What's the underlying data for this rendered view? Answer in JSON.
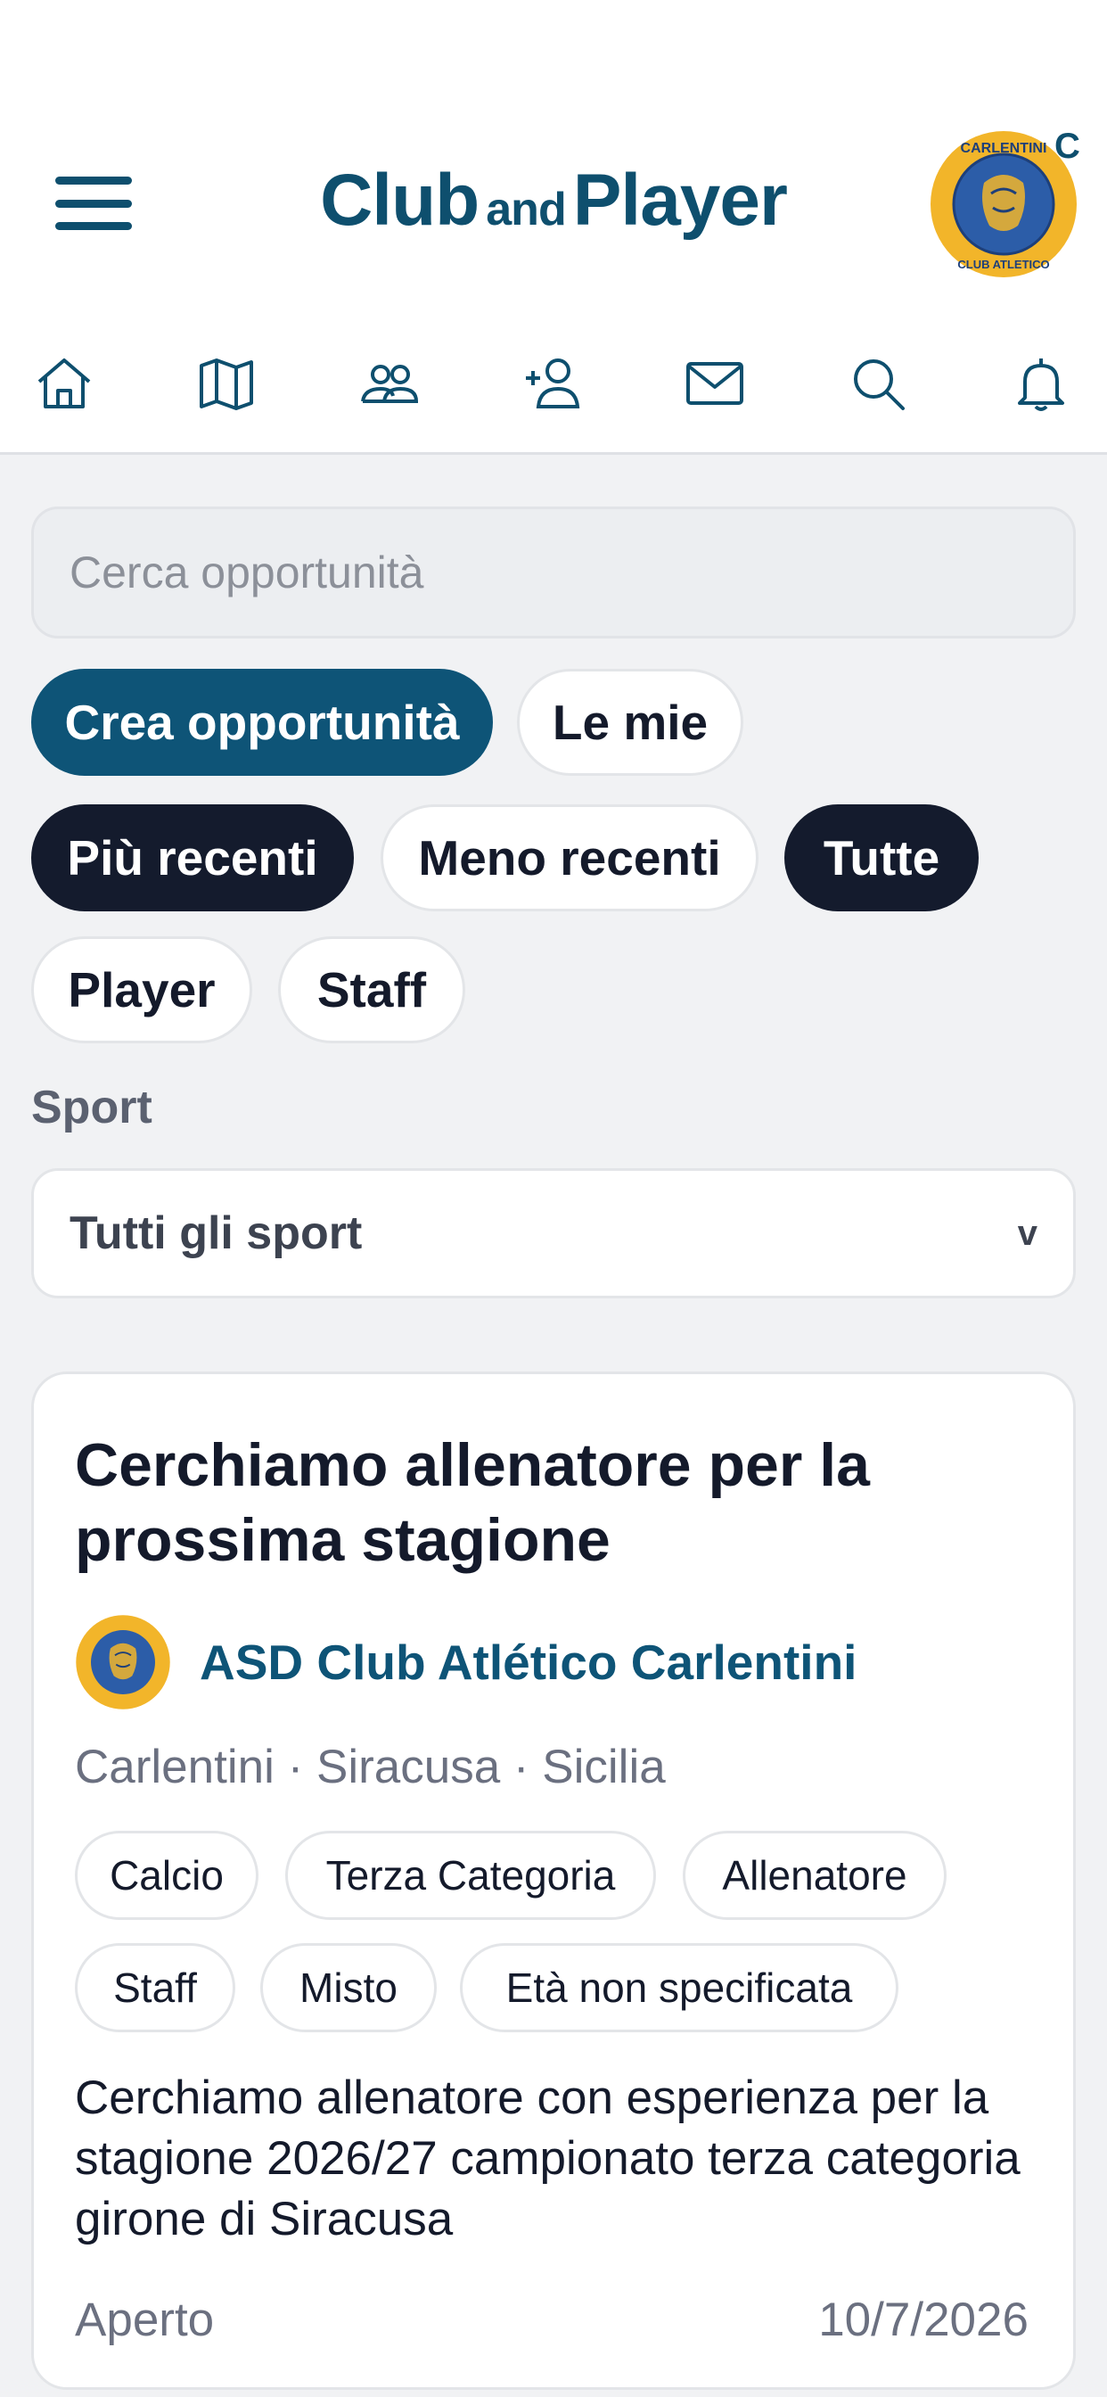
{
  "header": {
    "logo_club": "Club",
    "logo_and": "and",
    "logo_player": "Player",
    "avatar_badge": "C",
    "brand_color": "#0e4f6e"
  },
  "nav": {
    "icons": [
      "home-icon",
      "map-icon",
      "people-icon",
      "add-person-icon",
      "mail-icon",
      "search-icon",
      "bell-icon"
    ]
  },
  "search": {
    "placeholder": "Cerca opportunità"
  },
  "actions": {
    "create": "Crea opportunità",
    "mine": "Le mie"
  },
  "filters": {
    "most_recent": "Più recenti",
    "least_recent": "Meno recenti",
    "all": "Tutte",
    "player": "Player",
    "staff": "Staff"
  },
  "sport": {
    "label": "Sport",
    "selected": "Tutti gli sport",
    "chevron": "v"
  },
  "card": {
    "title": "Cerchiamo allenatore per la prossima stagione",
    "club_name": "ASD Club Atlético Carlentini",
    "location": "Carlentini · Siracusa · Sicilia",
    "tags": [
      "Calcio",
      "Terza Categoria",
      "Allenatore",
      "Staff",
      "Misto",
      "Età non specificata"
    ],
    "description": "Cerchiamo allenatore con esperienza per la stagione 2026/27 campionato terza categoria girone di Siracusa",
    "status": "Aperto",
    "date": "10/7/2026"
  },
  "badge_text": {
    "top": "CARLENTINI",
    "bottom": "CLUB ATLETICO"
  }
}
